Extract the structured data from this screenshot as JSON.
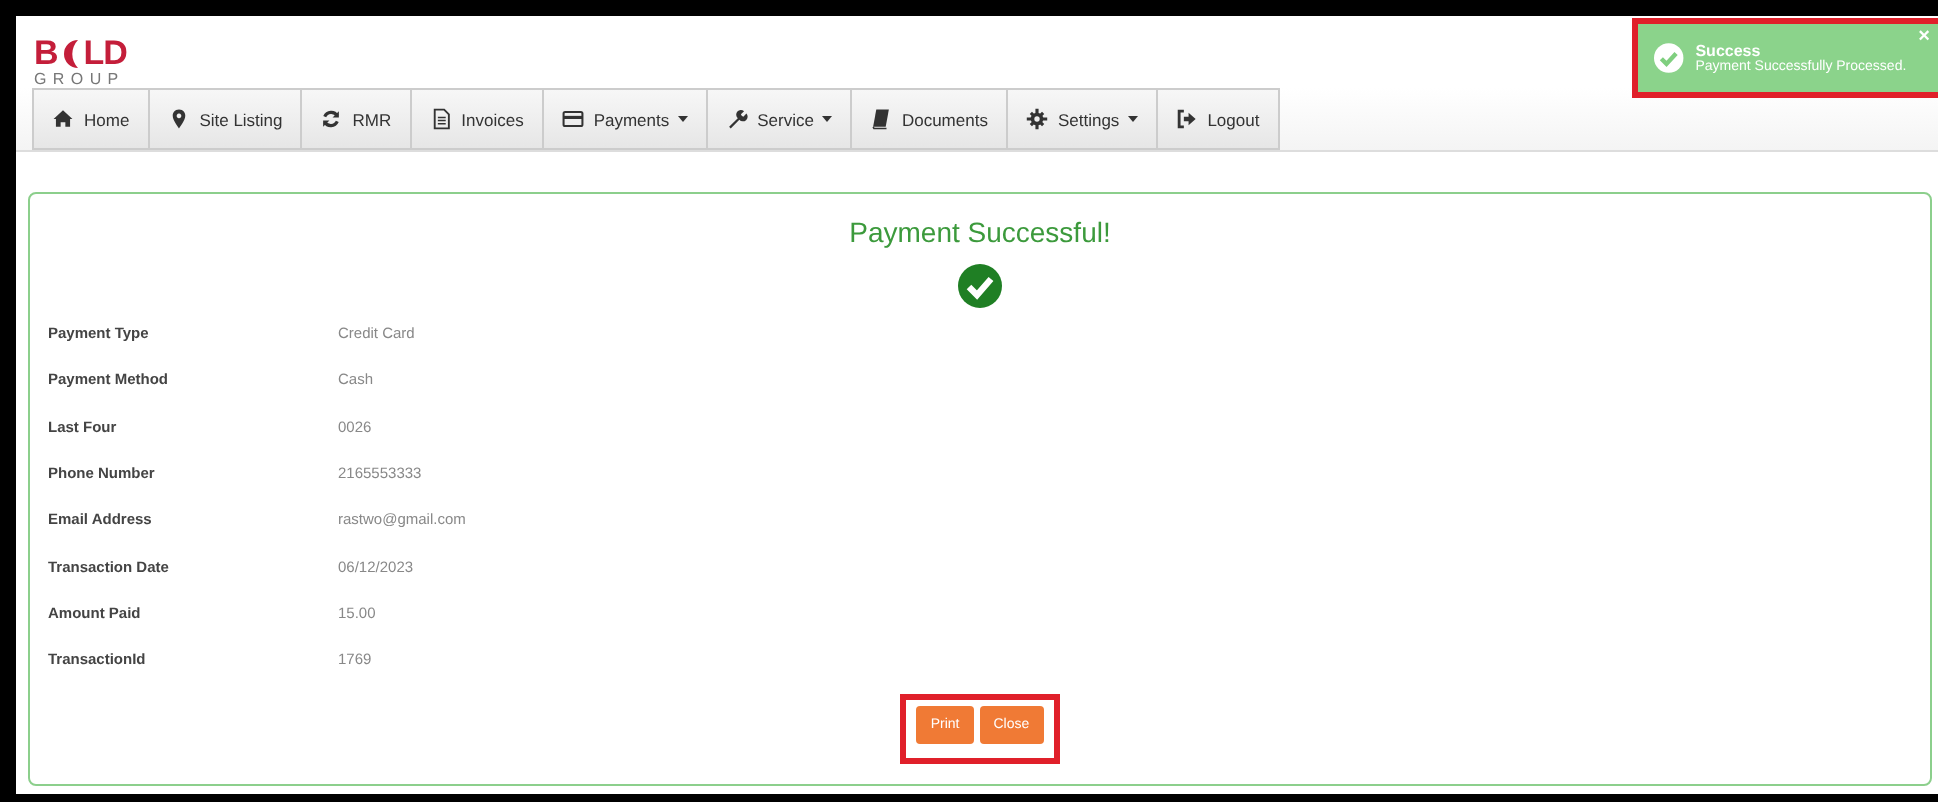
{
  "logo": {
    "start": "B",
    "end": "LD",
    "subtitle": "GROUP"
  },
  "nav": [
    {
      "label": "Home",
      "dropdown": false
    },
    {
      "label": "Site Listing",
      "dropdown": false
    },
    {
      "label": "RMR",
      "dropdown": false
    },
    {
      "label": "Invoices",
      "dropdown": false
    },
    {
      "label": "Payments",
      "dropdown": true
    },
    {
      "label": "Service",
      "dropdown": true
    },
    {
      "label": "Documents",
      "dropdown": false
    },
    {
      "label": "Settings",
      "dropdown": true
    },
    {
      "label": "Logout",
      "dropdown": false
    }
  ],
  "toast": {
    "title": "Success",
    "message": "Payment Successfully Processed.",
    "close": "×",
    "highlighted": true
  },
  "card": {
    "title": "Payment Successful!",
    "fields": [
      {
        "label": "Payment Type",
        "value": "Credit Card"
      },
      {
        "label": "Payment Method",
        "value": "Cash"
      },
      {
        "label": "Last Four",
        "value": "0026"
      },
      {
        "label": "Phone Number",
        "value": "2165553333"
      },
      {
        "label": "Email Address",
        "value": "rastwo@gmail.com"
      },
      {
        "label": "Transaction Date",
        "value": "06/12/2023"
      },
      {
        "label": "Amount Paid",
        "value": "15.00"
      },
      {
        "label": "TransactionId",
        "value": "1769"
      }
    ],
    "buttons": [
      "Print",
      "Close"
    ],
    "buttons_highlighted": true
  }
}
